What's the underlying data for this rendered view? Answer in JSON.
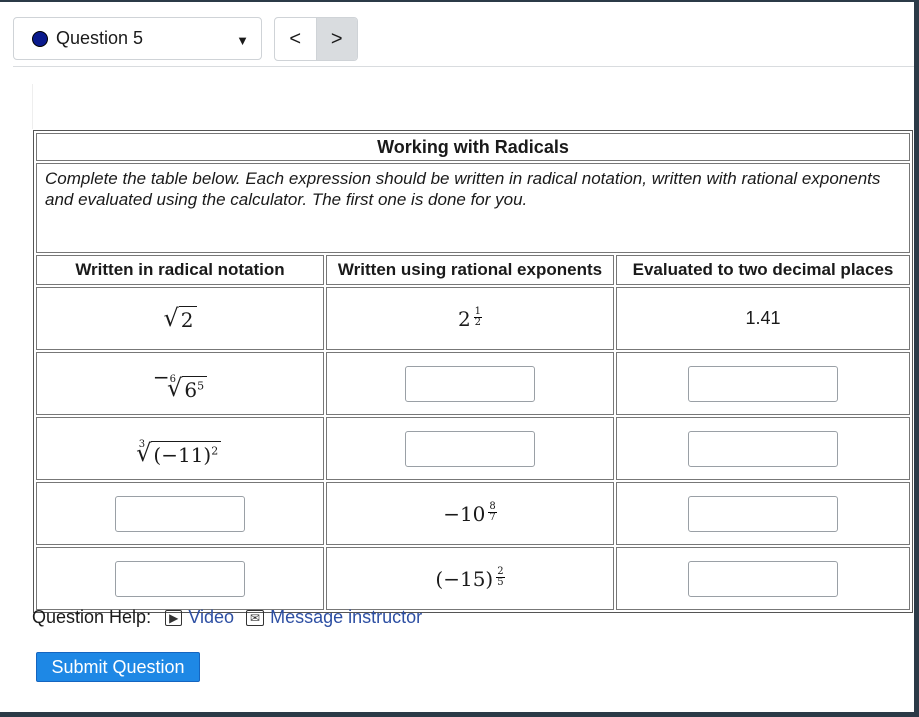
{
  "header": {
    "question_label": "Question 5",
    "prev_label": "<",
    "next_label": ">"
  },
  "table": {
    "title": "Working with Radicals",
    "instructions": "Complete the table below. Each expression should be written in radical notation, written with rational exponents and evaluated using the calculator. The first one is done for you.",
    "headers": [
      "Written in radical notation",
      "Written using rational exponents",
      "Evaluated to two decimal places"
    ],
    "rows": [
      {
        "radical": "√2",
        "rational": "2^(1/2)",
        "decimal": "1.41"
      },
      {
        "radical": "−⁶√(6⁵)",
        "rational": "",
        "decimal": ""
      },
      {
        "radical": "³√((−11)²)",
        "rational": "",
        "decimal": ""
      },
      {
        "radical": "",
        "rational": "−10^(8/7)",
        "decimal": ""
      },
      {
        "radical": "",
        "rational": "(−15)^(2/5)",
        "decimal": ""
      }
    ]
  },
  "help": {
    "label": "Question Help:",
    "video": "Video",
    "message": "Message instructor"
  },
  "submit_label": "Submit Question",
  "colors": {
    "accent": "#1e88e5",
    "link": "#2d4fa3",
    "dot": "#0a1a8c"
  }
}
